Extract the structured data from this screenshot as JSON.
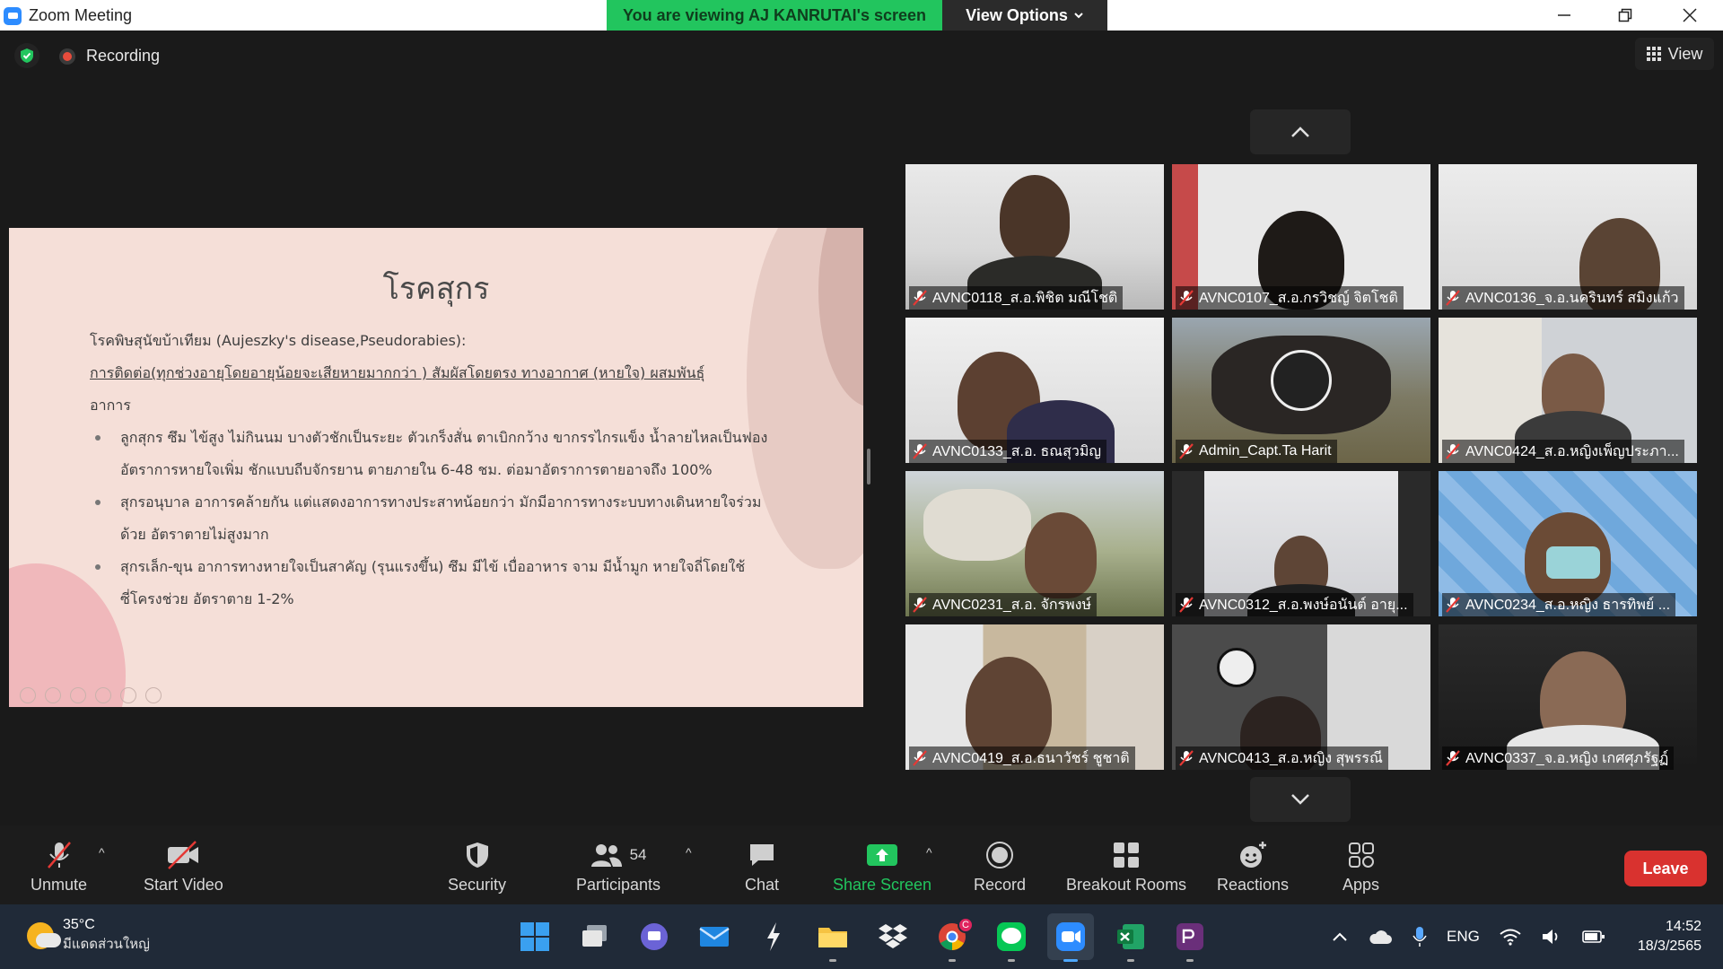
{
  "window": {
    "title": "Zoom Meeting"
  },
  "banner": {
    "viewing": "You are viewing AJ KANRUTAI's screen",
    "view_options": "View Options"
  },
  "status": {
    "recording": "Recording"
  },
  "view_button": {
    "label": "View"
  },
  "slide": {
    "title": "โรคสุกร",
    "lines": [
      "โรคพิษสุนัขบ้าเทียม (Aujeszky's disease,Pseudorabies):",
      "การติดต่อ(ทุกช่วงอายุโดยอายุน้อยจะเสียหายมากกว่า ) สัมผัสโดยตรง  ทางอากาศ (หายใจ) ผสมพันธุ์",
      "อาการ",
      "ลูกสุกร ซึม ไข้สูง ไม่กินนม บางตัวชักเป็นระยะ ตัวเกร็งสั่น ตาเบิกกว้าง ขากรรไกรแข็ง น้ำลายไหลเป็นฟอง",
      "อัตราการหายใจเพิ่ม ชักแบบถีบจักรยาน ตายภายใน 6-48 ชม. ต่อมาอัตราการตายอาจถึง 100%",
      "สุกรอนุบาล อาการคล้ายกัน แต่แสดงอาการทางประสาทน้อยกว่า มักมีอาการทางระบบทางเดินหายใจร่วม",
      "ด้วย อัตราตายไม่สูงมาก",
      "สุกรเล็ก-ขุน อาการทางหายใจเป็นสาคัญ (รุนแรงขึ้น) ซึม มีไข้ เบื่ออาหาร จาม มีน้ำมูก หายใจถี่โดยใช้",
      "ซี่โครงช่วย อัตราตาย 1-2%"
    ]
  },
  "participants_gallery": [
    {
      "name": "AVNC0118_ส.อ.พิชิต มณีโชติ"
    },
    {
      "name": "AVNC0107_ส.อ.กรวิชญ์ จิตโชติ"
    },
    {
      "name": "AVNC0136_จ.อ.นครินทร์ สมิงแก้ว"
    },
    {
      "name": "AVNC0133_ส.อ. ธณสุวมิญ"
    },
    {
      "name": "Admin_Capt.Ta Harit"
    },
    {
      "name": "AVNC0424_ส.อ.หญิงเพ็ญประภา..."
    },
    {
      "name": "AVNC0231_ส.อ. จักรพงษ์"
    },
    {
      "name": "AVNC0312_ส.อ.พงษ์อนันต์ อายุ..."
    },
    {
      "name": "AVNC0234_ส.อ.หญิง ธารทิพย์ ..."
    },
    {
      "name": "AVNC0419_ส.อ.ธนาวัชร์ ชูชาติ"
    },
    {
      "name": "AVNC0413_ส.อ.หญิง สุพรรณี"
    },
    {
      "name": "AVNC0337_จ.อ.หญิง เกศศุภรัฐฏ์"
    }
  ],
  "toolbar": {
    "unmute": "Unmute",
    "start_video": "Start Video",
    "security": "Security",
    "participants": "Participants",
    "participants_count": "54",
    "chat": "Chat",
    "share_screen": "Share Screen",
    "record": "Record",
    "breakout_rooms": "Breakout Rooms",
    "reactions": "Reactions",
    "apps": "Apps",
    "leave": "Leave"
  },
  "colors": {
    "share_green": "#22c55e",
    "leave_red": "#d9322f",
    "zoom_blue": "#2d8cff"
  },
  "taskbar": {
    "weather_temp": "35°C",
    "weather_desc": "มีแดดส่วนใหญ่",
    "language": "ENG",
    "time": "14:52",
    "date": "18/3/2565",
    "chrome_badge": "C"
  }
}
